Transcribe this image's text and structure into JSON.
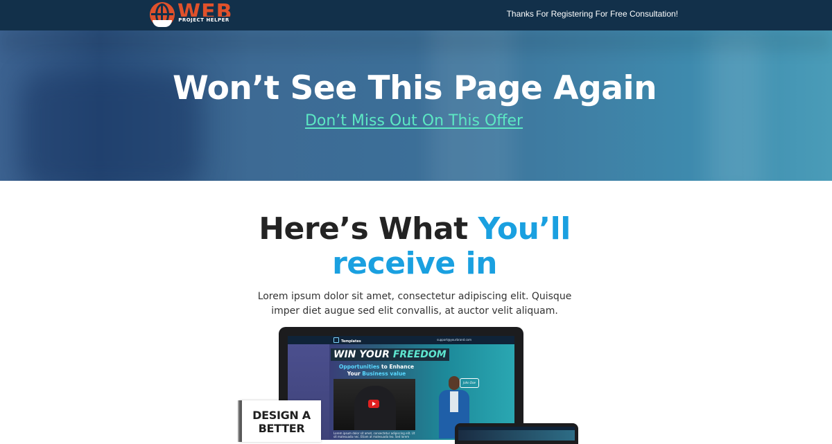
{
  "header": {
    "logo_text": "WEB",
    "logo_subtext": "PROJECT HELPER",
    "message": "Thanks For Registering For Free Consultation!"
  },
  "hero": {
    "title": "Won’t See This Page Again",
    "link": "Don’t Miss Out On This Offer"
  },
  "main": {
    "headline_part1": "Here’s What ",
    "headline_accent1": "You’ll",
    "headline_accent2": "receive in",
    "body": "Lorem ipsum dolor sit amet, consectetur adipiscing elit. Quisque imper diet augue sed elit convallis, at auctor velit aliquam."
  },
  "mockup": {
    "brand": "Templates",
    "contact": "support@yourbrand.com",
    "title_a": "WIN YOUR ",
    "title_b": "FREEDOM",
    "sub_1a": "Opportunities",
    "sub_1b": " to Enhance",
    "sub_2a": "Your ",
    "sub_2b": "Business value",
    "caption": "Lorem ipsum dolor sit amet, consectetur adipiscing elit. Ut sit malesuada nec. Etiam at malesuada leo. Sed lorem",
    "signature": "John Doe",
    "book_title": "DESIGN A BETTER"
  },
  "colors": {
    "nav_bg": "#12304a",
    "brand_orange": "#e0512b",
    "link_mint": "#5ce8c3",
    "accent_blue": "#1aa0e0",
    "heading_dark": "#232323"
  }
}
